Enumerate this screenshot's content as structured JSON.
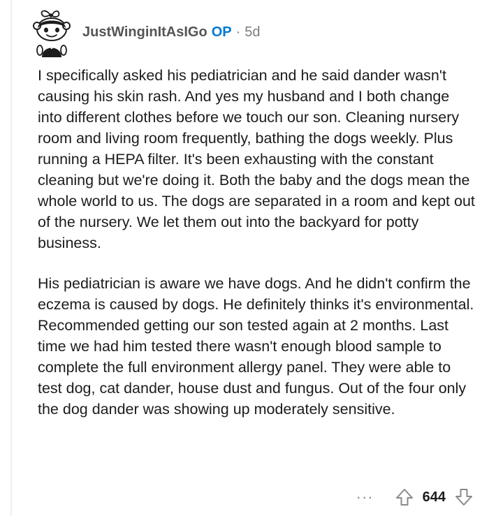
{
  "comment": {
    "author": "JustWinginItAsIGo",
    "op_badge": "OP",
    "separator": "·",
    "age": "5d",
    "paragraphs": [
      "I specifically asked his pediatrician and he said dander wasn't causing his skin rash. And yes my husband and I both change into different clothes before we touch our son. Cleaning nursery room and living room frequently, bathing the dogs weekly. Plus running a HEPA filter. It's been exhausting with the constant cleaning but we're doing it. Both the baby and the dogs mean the whole world to us. The dogs are separated in a room and kept out of the nursery. We let them out into the backyard for potty business.",
      "His pediatrician is aware we have dogs. And he didn't confirm the eczema is caused by dogs. He definitely thinks it's environmental. Recommended getting our son tested again at 2 months. Last time we had him tested there wasn't enough blood sample to complete the full environment allergy panel. They were able to test dog, cat dander, house dust and fungus. Out of the four only the dog dander was showing up moderately sensitive."
    ],
    "more_label": "···",
    "score": "644",
    "icons": {
      "avatar": "snoo-avatar-icon",
      "upvote": "upvote-arrow-icon",
      "downvote": "downvote-arrow-icon",
      "more": "more-options-icon"
    },
    "colors": {
      "op_badge": "#0079d3",
      "username": "#555555",
      "meta": "#7c7c7c",
      "text": "#1c1c1c",
      "thread_line": "#edeff1"
    }
  }
}
